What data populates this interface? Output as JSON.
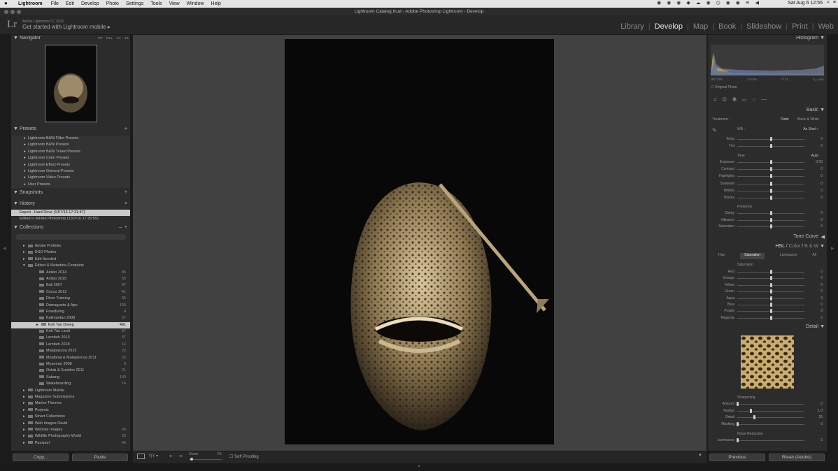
{
  "menubar": {
    "app": "Lightroom",
    "items": [
      "File",
      "Edit",
      "Develop",
      "Photo",
      "Settings",
      "Tools",
      "View",
      "Window",
      "Help"
    ],
    "clock": "Sat Aug 6  12:55"
  },
  "title": "Lightroom Catalog.lrcat - Adobe Photoshop Lightroom - Develop",
  "identity": {
    "logo": "Lr",
    "product": "Adobe Lightroom CC 2015",
    "mobile": "Get started with Lightroom mobile ▸"
  },
  "modules": [
    "Library",
    "Develop",
    "Map",
    "Book",
    "Slideshow",
    "Print",
    "Web"
  ],
  "active_module": "Develop",
  "navigator": {
    "title": "Navigator",
    "zoom_options": [
      "FIT",
      "FILL",
      "1:1",
      "4:1"
    ]
  },
  "presets": {
    "title": "Presets",
    "items": [
      "Lightroom B&W Filter Presets",
      "Lightroom B&W Presets",
      "Lightroom B&W Toned Presets",
      "Lightroom Color Presets",
      "Lightroom Effect Presets",
      "Lightroom General Presets",
      "Lightroom Video Presets",
      "User Presets"
    ]
  },
  "snapshots": {
    "title": "Snapshots"
  },
  "history": {
    "title": "History",
    "items": [
      "Export - Hard Drive (13/7/16 17:31:47)",
      "Edited in Adobe Photoshop (13/7/16 17:25:55)"
    ]
  },
  "collections": {
    "title": "Collections",
    "items": [
      {
        "name": "Adobe Portfolio",
        "count": "",
        "level": 0
      },
      {
        "name": "DSO Photos",
        "count": "",
        "level": 0
      },
      {
        "name": "Edit Needed",
        "count": "",
        "level": 0
      },
      {
        "name": "Edited & Metadata Complete",
        "count": "",
        "level": 0
      },
      {
        "name": "Anilao 2014",
        "count": "85",
        "level": 1
      },
      {
        "name": "Anilao 2015",
        "count": "55",
        "level": 1
      },
      {
        "name": "Bali 2007",
        "count": "47",
        "level": 1
      },
      {
        "name": "Cocos 2012",
        "count": "41",
        "level": 1
      },
      {
        "name": "Diver Training",
        "count": "35",
        "level": 1
      },
      {
        "name": "Dumaguete & Apo",
        "count": "155",
        "level": 1
      },
      {
        "name": "Freediving",
        "count": "4",
        "level": 1
      },
      {
        "name": "Kalimantan 2008",
        "count": "57",
        "level": 1
      },
      {
        "name": "Koh Tao Diving",
        "count": "491",
        "level": 1,
        "selected": true
      },
      {
        "name": "Koh Tao Land",
        "count": "57",
        "level": 1
      },
      {
        "name": "Lembeh 2013",
        "count": "57",
        "level": 1
      },
      {
        "name": "Lembeh 2018",
        "count": "14",
        "level": 1
      },
      {
        "name": "Malapascua 2015",
        "count": "22",
        "level": 1
      },
      {
        "name": "Moalboal & Malapascua 2011",
        "count": "32",
        "level": 1
      },
      {
        "name": "Myanmar 2008",
        "count": "3",
        "level": 1
      },
      {
        "name": "Oslob & Sumilon 2011",
        "count": "21",
        "level": 1
      },
      {
        "name": "Sabang",
        "count": "149",
        "level": 1
      },
      {
        "name": "Wakeboarding",
        "count": "14",
        "level": 1
      },
      {
        "name": "Lightroom Mobile",
        "count": "",
        "level": 0
      },
      {
        "name": "Magazine Submissions",
        "count": "",
        "level": 0
      },
      {
        "name": "Marine Themes",
        "count": "",
        "level": 0
      },
      {
        "name": "Projects",
        "count": "",
        "level": 0
      },
      {
        "name": "Smart Collections",
        "count": "",
        "level": 0
      },
      {
        "name": "Web Images David",
        "count": "",
        "level": 0
      },
      {
        "name": "Website Images",
        "count": "64",
        "level": 0
      },
      {
        "name": "Wildlife Photography World",
        "count": "20",
        "level": 0
      },
      {
        "name": "Passport",
        "count": "45",
        "level": 0
      }
    ]
  },
  "left_buttons": {
    "copy": "Copy...",
    "paste": "Paste"
  },
  "histogram": {
    "title": "Histogram",
    "info": [
      "ISO 200",
      "17 mm",
      "f / 11",
      "¹⁄₁₂₅ sec"
    ],
    "original_photo": "Original Photo"
  },
  "basic": {
    "title": "Basic",
    "treatment_label": "Treatment :",
    "treatment_color": "Color",
    "treatment_bw": "Black & White",
    "wb_label": "WB :",
    "wb_value": "As Shot ÷",
    "wb_sliders": [
      {
        "label": "Temp",
        "value": "0",
        "pos": 0.5
      },
      {
        "label": "Tint",
        "value": "0",
        "pos": 0.5
      }
    ],
    "tone_label": "Tone",
    "auto": "Auto",
    "tone_sliders": [
      {
        "label": "Exposure",
        "value": "0.00",
        "pos": 0.5
      },
      {
        "label": "Contrast",
        "value": "0",
        "pos": 0.5
      },
      {
        "label": "Highlights",
        "value": "0",
        "pos": 0.5
      },
      {
        "label": "Shadows",
        "value": "0",
        "pos": 0.5
      },
      {
        "label": "Whites",
        "value": "0",
        "pos": 0.5
      },
      {
        "label": "Blacks",
        "value": "0",
        "pos": 0.5
      }
    ],
    "presence_label": "Presence",
    "presence_sliders": [
      {
        "label": "Clarity",
        "value": "0",
        "pos": 0.5
      },
      {
        "label": "Vibrance",
        "value": "0",
        "pos": 0.5
      },
      {
        "label": "Saturation",
        "value": "0",
        "pos": 0.5
      }
    ]
  },
  "tone_curve": {
    "title": "Tone Curve"
  },
  "hsl": {
    "title_hsl": "HSL",
    "title_color": "Color",
    "title_bw": "B & W",
    "tabs": [
      "Hue",
      "Saturation",
      "Luminance",
      "All"
    ],
    "active_tab": "Saturation",
    "section": "Saturation",
    "sliders": [
      {
        "label": "Red",
        "value": "0",
        "pos": 0.5
      },
      {
        "label": "Orange",
        "value": "0",
        "pos": 0.5
      },
      {
        "label": "Yellow",
        "value": "0",
        "pos": 0.5
      },
      {
        "label": "Green",
        "value": "0",
        "pos": 0.5
      },
      {
        "label": "Aqua",
        "value": "0",
        "pos": 0.5
      },
      {
        "label": "Blue",
        "value": "0",
        "pos": 0.5
      },
      {
        "label": "Purple",
        "value": "0",
        "pos": 0.5
      },
      {
        "label": "Magenta",
        "value": "0",
        "pos": 0.5
      }
    ]
  },
  "detail": {
    "title": "Detail",
    "sharpening": "Sharpening",
    "sharp_sliders": [
      {
        "label": "Amount",
        "value": "0",
        "pos": 0.0
      },
      {
        "label": "Radius",
        "value": "1.0",
        "pos": 0.2
      },
      {
        "label": "Detail",
        "value": "25",
        "pos": 0.25
      },
      {
        "label": "Masking",
        "value": "0",
        "pos": 0.0
      }
    ],
    "noise": "Noise Reduction",
    "noise_sliders": [
      {
        "label": "Luminance",
        "value": "0",
        "pos": 0.0
      }
    ]
  },
  "right_buttons": {
    "previous": "Previous",
    "reset": "Reset (Adobe)"
  },
  "toolbar": {
    "zoom": "Zoom",
    "fit": "Fit",
    "soft_proofing": "Soft Proofing"
  }
}
